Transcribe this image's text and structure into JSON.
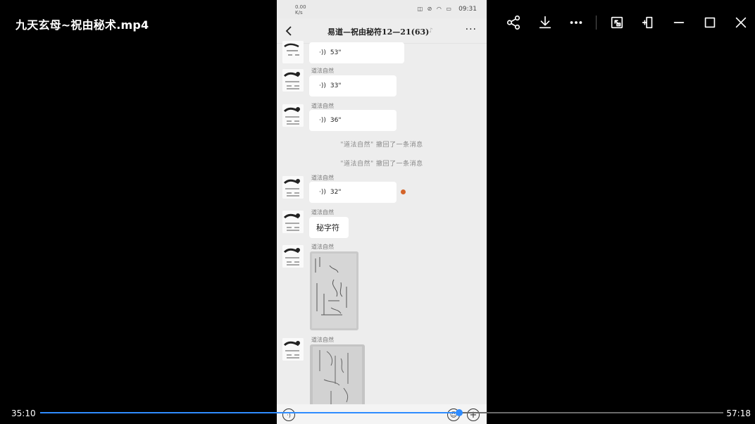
{
  "player": {
    "title": "九天玄母~祝由秘术.mp4",
    "time_current": "35:10",
    "time_total": "57:18",
    "progress_fraction": 0.6138,
    "accent_color": "#2f8cff",
    "toolbar_icons": [
      "share-icon",
      "download-icon",
      "more-icon",
      "picture-in-picture-icon",
      "pin-icon",
      "minimize-icon",
      "maximize-icon",
      "close-icon"
    ]
  },
  "video": {
    "status_bar": {
      "left_speed": "0.00",
      "left_unit": "K/s",
      "time": "09:31",
      "icons": "◫ ⊘ ◠ ▭"
    },
    "chat": {
      "title": "易道—祝由秘符12—21(63)",
      "messages": [
        {
          "type": "voice",
          "duration": "53\""
        },
        {
          "type": "voice",
          "sender": "道法自然",
          "duration": "33\""
        },
        {
          "type": "voice",
          "sender": "道法自然",
          "duration": "36\""
        },
        {
          "type": "recall",
          "text": "\"道法自然\" 撤回了一条消息"
        },
        {
          "type": "recall",
          "text": "\"道法自然\" 撤回了一条消息"
        },
        {
          "type": "voice",
          "sender": "道法自然",
          "duration": "32\""
        },
        {
          "type": "text",
          "sender": "道法自然",
          "text": "秘字符"
        },
        {
          "type": "image",
          "sender": "道法自然"
        },
        {
          "type": "image",
          "sender": "道法自然"
        }
      ]
    }
  }
}
